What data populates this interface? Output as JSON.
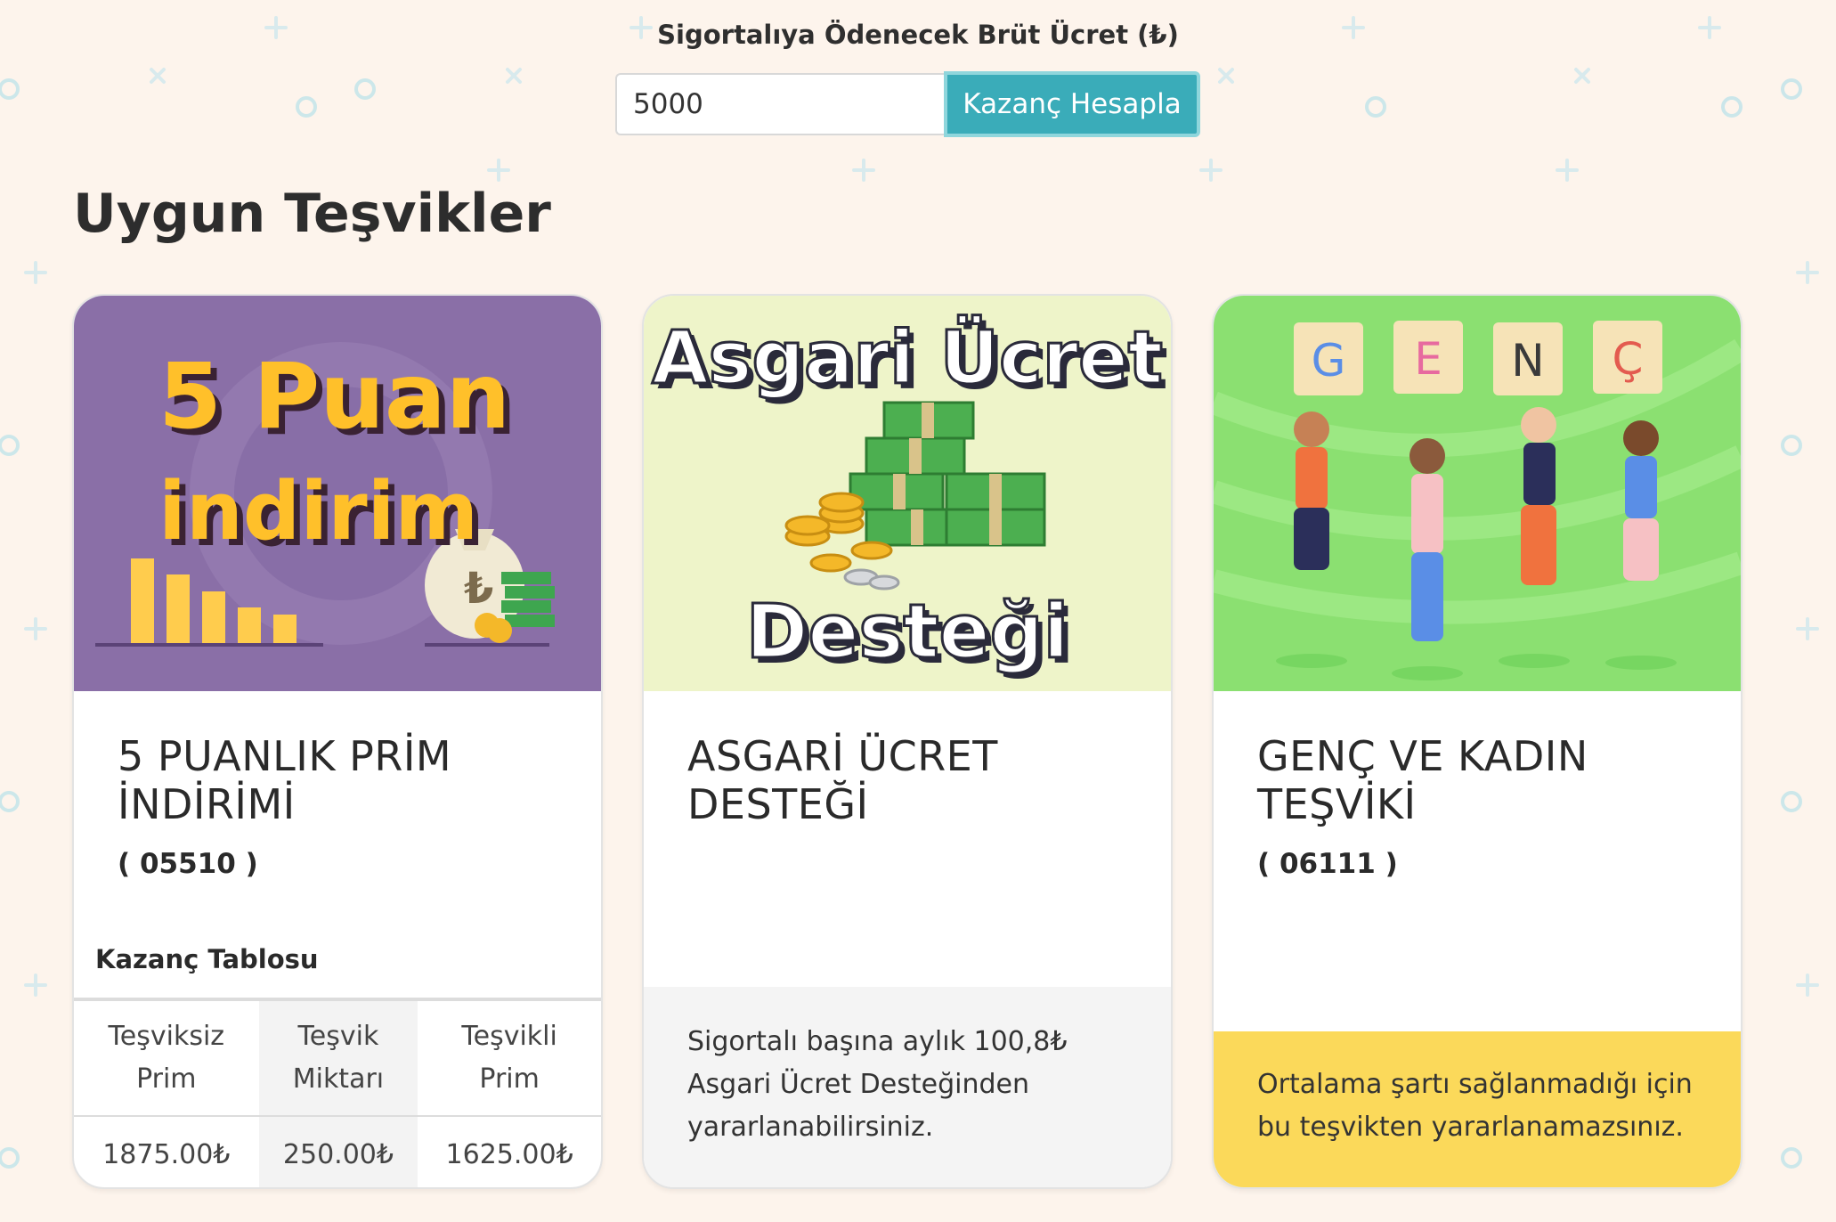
{
  "form": {
    "label": "Sigortalıya Ödenecek Brüt Ücret (₺)",
    "input_value": "5000",
    "button_label": "Kazanç Hesapla"
  },
  "section_title": "Uygun Teşvikler",
  "colors": {
    "page_background": "#fdf4ec",
    "button": "#3aacb9",
    "card1_image_bg": "#8a6fa7",
    "card2_image_bg": "#eef4c9",
    "card3_image_bg": "#8be071",
    "yellow_note": "#fbd95a"
  },
  "cards": [
    {
      "image_text": {
        "line1": "5 Puan",
        "line2": "indirim"
      },
      "title_line1": "5 PUANLIK PRİM",
      "title_line2": "İNDİRİMİ",
      "code": "( 05510 )",
      "table_caption": "Kazanç Tablosu",
      "table": {
        "headers": [
          {
            "line1": "Teşviksiz",
            "line2": "Prim"
          },
          {
            "line1": "Teşvik",
            "line2": "Miktarı"
          },
          {
            "line1": "Teşvikli",
            "line2": "Prim"
          }
        ],
        "row": [
          "1875.00₺",
          "250.00₺",
          "1625.00₺"
        ]
      }
    },
    {
      "image_text": {
        "line1": "Asgari Ücret",
        "line2": "Desteği"
      },
      "title_line1": "ASGARİ ÜCRET",
      "title_line2": "DESTEĞİ",
      "note": "Sigortalı başına aylık 100,8₺ Asgari Ücret Desteğinden yararlanabilirsiniz."
    },
    {
      "image_text": {
        "letters": [
          "G",
          "E",
          "N",
          "Ç"
        ]
      },
      "title_line1": "GENÇ VE KADIN",
      "title_line2": "TEŞVİKİ",
      "code": "( 06111 )",
      "note": "Ortalama şartı sağlanmadığı için bu teşvikten yararlanamazsınız."
    }
  ]
}
